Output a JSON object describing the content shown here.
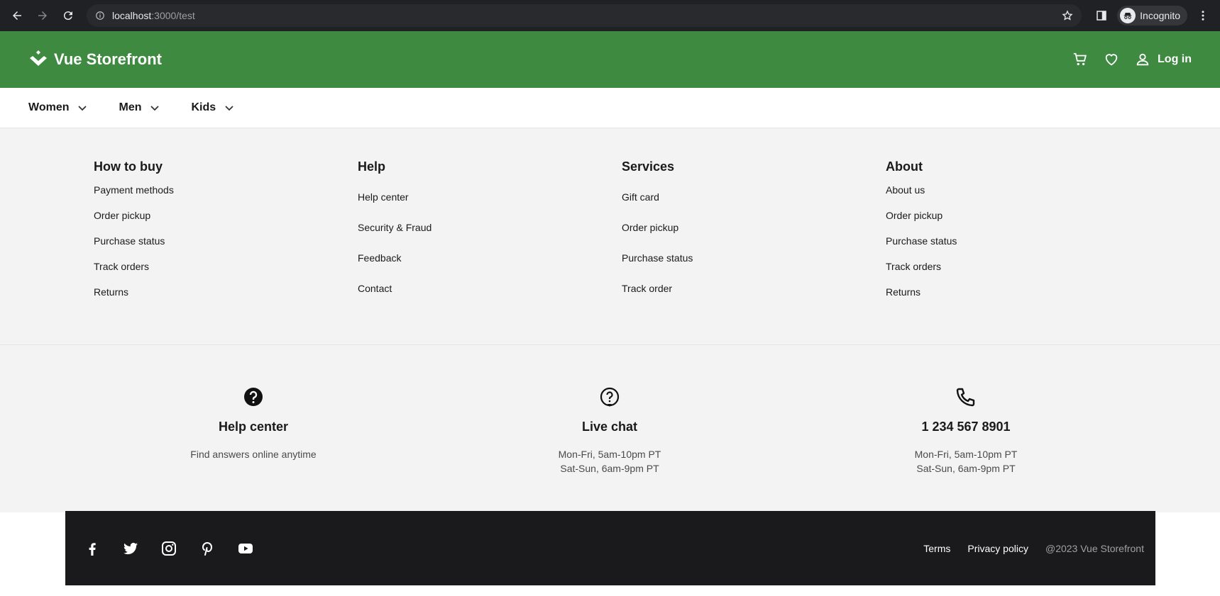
{
  "browser": {
    "url_host": "localhost",
    "url_path": ":3000/test",
    "profile_label": "Incognito"
  },
  "header": {
    "brand": "Vue Storefront",
    "login_label": "Log in"
  },
  "categories": [
    "Women",
    "Men",
    "Kids"
  ],
  "footer_columns": [
    {
      "title": "How to buy",
      "links": [
        "Payment methods",
        "Order pickup",
        "Purchase status",
        "Track orders",
        "Returns"
      ]
    },
    {
      "title": "Help",
      "links": [
        "Help center",
        "Security & Fraud",
        "Feedback",
        "Contact"
      ]
    },
    {
      "title": "Services",
      "links": [
        "Gift card",
        "Order pickup",
        "Purchase status",
        "Track order"
      ]
    },
    {
      "title": "About",
      "links": [
        "About us",
        "Order pickup",
        "Purchase status",
        "Track orders",
        "Returns"
      ]
    }
  ],
  "contact": [
    {
      "icon": "help-icon",
      "title": "Help center",
      "lines": [
        "Find answers online anytime"
      ]
    },
    {
      "icon": "chat-icon",
      "title": "Live chat",
      "lines": [
        "Mon-Fri, 5am-10pm PT",
        "Sat-Sun, 6am-9pm PT"
      ]
    },
    {
      "icon": "phone-icon",
      "title": "1 234 567 8901",
      "lines": [
        "Mon-Fri, 5am-10pm PT",
        "Sat-Sun, 6am-9pm PT"
      ]
    }
  ],
  "bottom_bar": {
    "terms": "Terms",
    "privacy": "Privacy policy",
    "copyright": "@2023 Vue Storefront"
  },
  "colors": {
    "header_bg": "#3d8a40",
    "bottom_bg": "#1a1a1d",
    "footer_bg": "#f3f3f3"
  }
}
